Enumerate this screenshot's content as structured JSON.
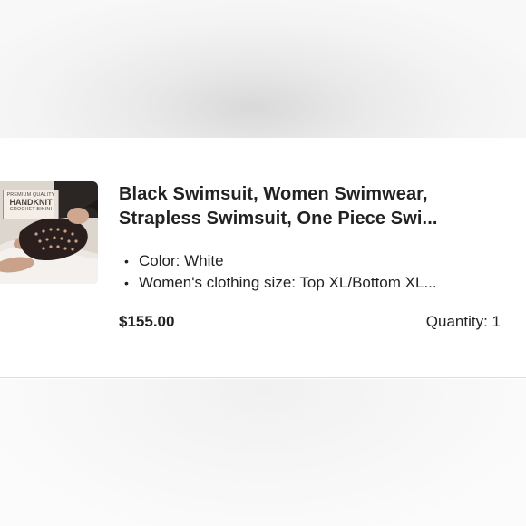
{
  "listing": {
    "thumbnail": {
      "badge_line1": "PREMIUM QUALITY",
      "badge_line2": "HANDKNIT",
      "badge_line3": "CROCHET BIKINI"
    },
    "title_line1": "Black Swimsuit, Women Swimwear,",
    "title_line2": "Strapless Swimsuit, One Piece Swi...",
    "attributes": [
      "Color: White",
      "Women's clothing size: Top XL/Bottom XL..."
    ],
    "bullet": "•",
    "price": "$155.00",
    "quantity": "Quantity: 1"
  }
}
